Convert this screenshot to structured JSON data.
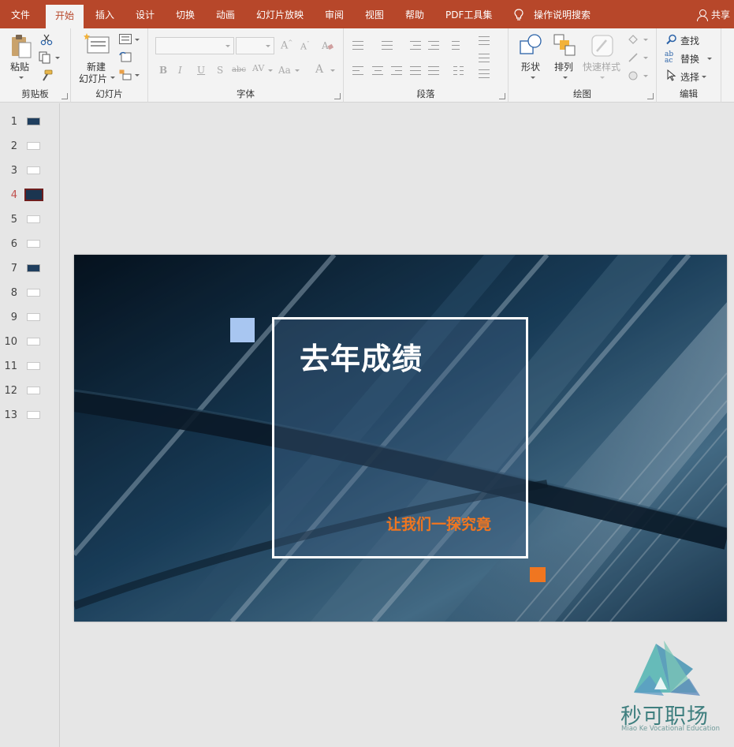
{
  "tabs": [
    {
      "label": "文件"
    },
    {
      "label": "开始"
    },
    {
      "label": "插入"
    },
    {
      "label": "设计"
    },
    {
      "label": "切换"
    },
    {
      "label": "动画"
    },
    {
      "label": "幻灯片放映"
    },
    {
      "label": "审阅"
    },
    {
      "label": "视图"
    },
    {
      "label": "帮助"
    },
    {
      "label": "PDF工具集"
    }
  ],
  "active_tab": "开始",
  "search_label": "操作说明搜索",
  "share_label": "共享",
  "ribbon": {
    "clipboard": {
      "label": "剪贴板",
      "paste": "粘贴"
    },
    "slides": {
      "label": "幻灯片",
      "new_slide_1": "新建",
      "new_slide_2": "幻灯片"
    },
    "font": {
      "label": "字体",
      "font_name": "",
      "font_size": ""
    },
    "paragraph": {
      "label": "段落"
    },
    "drawing": {
      "label": "绘图",
      "shapes": "形状",
      "arrange": "排列",
      "quick_styles": "快速样式"
    },
    "editing": {
      "label": "编辑",
      "find": "查找",
      "replace": "替换",
      "select": "选择"
    }
  },
  "thumbnails": [
    {
      "num": "1"
    },
    {
      "num": "2"
    },
    {
      "num": "3"
    },
    {
      "num": "4"
    },
    {
      "num": "5"
    },
    {
      "num": "6"
    },
    {
      "num": "7"
    },
    {
      "num": "8"
    },
    {
      "num": "9"
    },
    {
      "num": "10"
    },
    {
      "num": "11"
    },
    {
      "num": "12"
    },
    {
      "num": "13"
    }
  ],
  "active_slide": 4,
  "slide": {
    "title": "去年成绩",
    "subtitle": "让我们一探究竟",
    "accent_orange": "#f07620",
    "accent_blue": "#a8c6f1"
  },
  "watermark": {
    "name": "秒可职场",
    "name_en": "Miao Ke Vocational Education"
  },
  "colors": {
    "brand": "#b7472a",
    "ribbon_bg": "#f3f3f3",
    "canvas_bg": "#e6e6e6"
  }
}
